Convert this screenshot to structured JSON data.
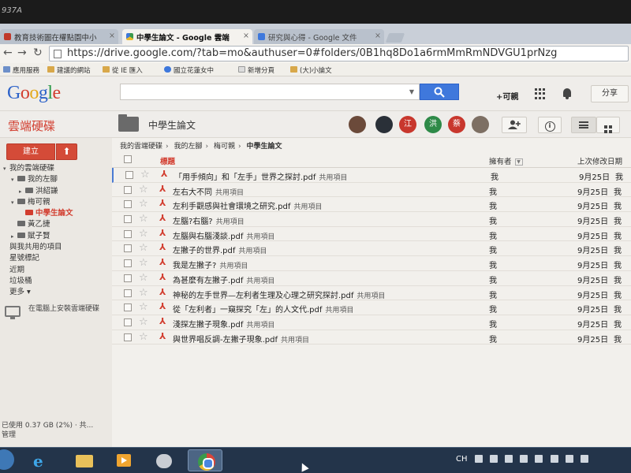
{
  "bezel": {
    "label": "937A"
  },
  "browser": {
    "tabs": [
      {
        "label": "教育技術圖在權點園中小",
        "active": false
      },
      {
        "label": "中學生論文 - Google 雲端",
        "active": true
      },
      {
        "label": "研究與心得 - Google 文件",
        "active": false
      }
    ],
    "url": "https://drive.google.com/?tab=mo&authuser=0#folders/0B1hq8Do1a6rmMmRmNDVGU1prNzg",
    "bookmarks": [
      "應用服務",
      "建議的網站",
      "從 IE 匯入",
      "國立花蓮女中",
      "新增分頁",
      "(大)小論文"
    ]
  },
  "google": {
    "logo": "Google",
    "search_button_icon": "search-icon",
    "user": "+可親",
    "share_label": "分享"
  },
  "drive": {
    "title": "雲端硬碟",
    "folder_title": "中學生論文",
    "avatars": [
      {
        "label": "",
        "color": "#6b4a3a"
      },
      {
        "label": "",
        "color": "#2a3038"
      },
      {
        "label": "江",
        "color": "#c8372d"
      },
      {
        "label": "洪",
        "color": "#2e8a48"
      },
      {
        "label": "蔡",
        "color": "#c8372d"
      },
      {
        "label": "",
        "color": "#7d6f63"
      }
    ],
    "add_person_icon": "add-person-icon",
    "details_icon": "info-icon"
  },
  "sidebar": {
    "new_label": "建立",
    "upload_icon": "upload-icon",
    "nav": [
      {
        "label": "我的雲端硬碟",
        "level": 0,
        "arrow": "▾",
        "folder": false,
        "active": false
      },
      {
        "label": "我的左腳",
        "level": 1,
        "arrow": "▾",
        "folder": true,
        "active": false
      },
      {
        "label": "洪紹謙",
        "level": 2,
        "arrow": "▸",
        "folder": true,
        "active": false
      },
      {
        "label": "梅可親",
        "level": 1,
        "arrow": "▾",
        "folder": true,
        "active": false
      },
      {
        "label": "中學生論文",
        "level": 2,
        "arrow": "",
        "folder": true,
        "active": true
      },
      {
        "label": "黃乙捷",
        "level": 1,
        "arrow": "",
        "folder": true,
        "active": false
      },
      {
        "label": "賦子賢",
        "level": 1,
        "arrow": "▸",
        "folder": true,
        "active": false
      },
      {
        "label": "與我共用的項目",
        "level": 0,
        "arrow": "",
        "folder": false,
        "active": false
      },
      {
        "label": "星號標記",
        "level": 0,
        "arrow": "",
        "folder": false,
        "active": false
      },
      {
        "label": "近期",
        "level": 0,
        "arrow": "",
        "folder": false,
        "active": false
      },
      {
        "label": "垃圾桶",
        "level": 0,
        "arrow": "",
        "folder": false,
        "active": false
      },
      {
        "label": "更多 ▾",
        "level": 0,
        "arrow": "",
        "folder": false,
        "active": false
      }
    ],
    "install_label": "在電腦上安裝雲端硬碟",
    "storage": "已使用 0.37 GB (2%) · 共...",
    "manage": "管理"
  },
  "main": {
    "breadcrumb": [
      "我的雲端硬碟",
      "我的左腳",
      "梅可親",
      "中學生論文"
    ],
    "columns": {
      "title": "標題",
      "owner": "擁有者",
      "modified": "上次修改日期"
    },
    "files": [
      {
        "name": "「用手傾向」和「左手」世界之探討.pdf",
        "shared": "共用項目",
        "owner": "我",
        "date": "9月25日",
        "by": "我",
        "selected": true
      },
      {
        "name": "左右大不同",
        "shared": "共用項目",
        "owner": "我",
        "date": "9月25日",
        "by": "我",
        "selected": false
      },
      {
        "name": "左利手觀感與社會環境之研究.pdf",
        "shared": "共用項目",
        "owner": "我",
        "date": "9月25日",
        "by": "我",
        "selected": false
      },
      {
        "name": "左腦?右腦?",
        "shared": "共用項目",
        "owner": "我",
        "date": "9月25日",
        "by": "我",
        "selected": false
      },
      {
        "name": "左腦與右腦淺談.pdf",
        "shared": "共用項目",
        "owner": "我",
        "date": "9月25日",
        "by": "我",
        "selected": false
      },
      {
        "name": "左撇子的世界.pdf",
        "shared": "共用項目",
        "owner": "我",
        "date": "9月25日",
        "by": "我",
        "selected": false
      },
      {
        "name": "我是左撇子?",
        "shared": "共用項目",
        "owner": "我",
        "date": "9月25日",
        "by": "我",
        "selected": false
      },
      {
        "name": "為甚麼有左撇子.pdf",
        "shared": "共用項目",
        "owner": "我",
        "date": "9月25日",
        "by": "我",
        "selected": false
      },
      {
        "name": "神秘的左手世界—左利者生理及心理之研究探討.pdf",
        "shared": "共用項目",
        "owner": "我",
        "date": "9月25日",
        "by": "我",
        "selected": false
      },
      {
        "name": "從「左利者」一窺探究「左」的人文代.pdf",
        "shared": "共用項目",
        "owner": "我",
        "date": "9月25日",
        "by": "我",
        "selected": false
      },
      {
        "name": "淺探左撇子現象.pdf",
        "shared": "共用項目",
        "owner": "我",
        "date": "9月25日",
        "by": "我",
        "selected": false
      },
      {
        "name": "與世界唱反調-左撇子現象.pdf",
        "shared": "共用項目",
        "owner": "我",
        "date": "9月25日",
        "by": "我",
        "selected": false
      }
    ]
  },
  "taskbar": {
    "apps": [
      "ie-icon",
      "explorer-icon",
      "media-player-icon",
      "tool-icon",
      "chrome-icon"
    ],
    "tray_label": "CH"
  }
}
